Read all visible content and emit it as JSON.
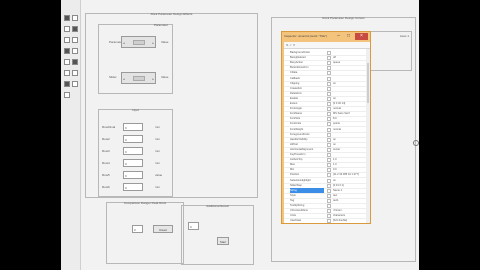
{
  "palette": {
    "tools": [
      "select-tool",
      "push-button-tool",
      "slider-tool",
      "radio-button-tool",
      "checkbox-tool",
      "edit-text-tool",
      "static-text-tool",
      "popup-menu-tool",
      "listbox-tool",
      "toggle-button-tool",
      "table-tool",
      "axes-tool",
      "panel-tool",
      "button-group-tool",
      "activex-tool"
    ]
  },
  "canvas": {
    "left_panel_title": "Rock Parameter Design Effects",
    "top_panel_title": "Parameter",
    "top_edit_label": "Parameter",
    "top_edit_label2": "Value",
    "slider_label": "Slider",
    "slider_label_right": "Value",
    "mid_panel_title": "Input",
    "rows": [
      {
        "label": "Row01val",
        "value": "0",
        "unit": "mm"
      },
      {
        "label": "Row2",
        "value": "0",
        "unit": "mm"
      },
      {
        "label": "Row3",
        "value": "0",
        "unit": "mm"
      },
      {
        "label": "Row4",
        "value": "0",
        "unit": "mm"
      },
      {
        "label": "Row5",
        "value": "0",
        "unit": "value"
      },
      {
        "label": "Row6",
        "value": "0",
        "unit": "mm"
      }
    ],
    "bottom_left_title": "Comparison Danger Peak Rock",
    "bottom_left_field": "0",
    "bottom_left_btn": "Read",
    "bottom_mid_title": "Additional Result",
    "bottom_mid_field": "0",
    "bottom_mid_btn": "Start",
    "right_panel_title": "Rock Parameter Design Curves",
    "axes_label": "Axes 1"
  },
  "inspector": {
    "title": "Inspector: uicontrol (text1 \"Title\")",
    "minimize": "–",
    "maximize": "□",
    "close": "×",
    "toolbar": "⇅ ✓ ✕",
    "properties": [
      {
        "name": "BackgroundColor",
        "value": ""
      },
      {
        "name": "BeingDeleted",
        "value": "off"
      },
      {
        "name": "BusyAction",
        "value": "queue"
      },
      {
        "name": "ButtonDownFcn",
        "value": ""
      },
      {
        "name": "CData",
        "value": ""
      },
      {
        "name": "Callback",
        "value": ""
      },
      {
        "name": "Clipping",
        "value": "on"
      },
      {
        "name": "CreateFcn",
        "value": ""
      },
      {
        "name": "DeleteFcn",
        "value": ""
      },
      {
        "name": "Enable",
        "value": "on"
      },
      {
        "name": "Extent",
        "value": "[0 0 30 14]"
      },
      {
        "name": "FontAngle",
        "value": "normal"
      },
      {
        "name": "FontName",
        "value": "MS Sans Serif"
      },
      {
        "name": "FontSize",
        "value": "8.0"
      },
      {
        "name": "FontUnits",
        "value": "points"
      },
      {
        "name": "FontWeight",
        "value": "normal"
      },
      {
        "name": "ForegroundColor",
        "value": ""
      },
      {
        "name": "HandleVisibility",
        "value": "on"
      },
      {
        "name": "HitTest",
        "value": "on"
      },
      {
        "name": "HorizontalAlignment",
        "value": "center"
      },
      {
        "name": "KeyPressFcn",
        "value": ""
      },
      {
        "name": "ListboxTop",
        "value": "1.0"
      },
      {
        "name": "Max",
        "value": "1.0"
      },
      {
        "name": "Min",
        "value": "0.0"
      },
      {
        "name": "Position",
        "value": "[11.2 33.385 10 1.077]"
      },
      {
        "name": "SelectionHighlight",
        "value": "on"
      },
      {
        "name": "SliderStep",
        "value": "[0.01 0.1]"
      },
      {
        "name": "String",
        "value": "Name 1"
      },
      {
        "name": "Style",
        "value": "text"
      },
      {
        "name": "Tag",
        "value": "text1"
      },
      {
        "name": "TooltipString",
        "value": ""
      },
      {
        "name": "UIContextMenu",
        "value": "<None>"
      },
      {
        "name": "Units",
        "value": "characters"
      },
      {
        "name": "UserData",
        "value": "[0x0 double]"
      }
    ],
    "selected": "String"
  }
}
